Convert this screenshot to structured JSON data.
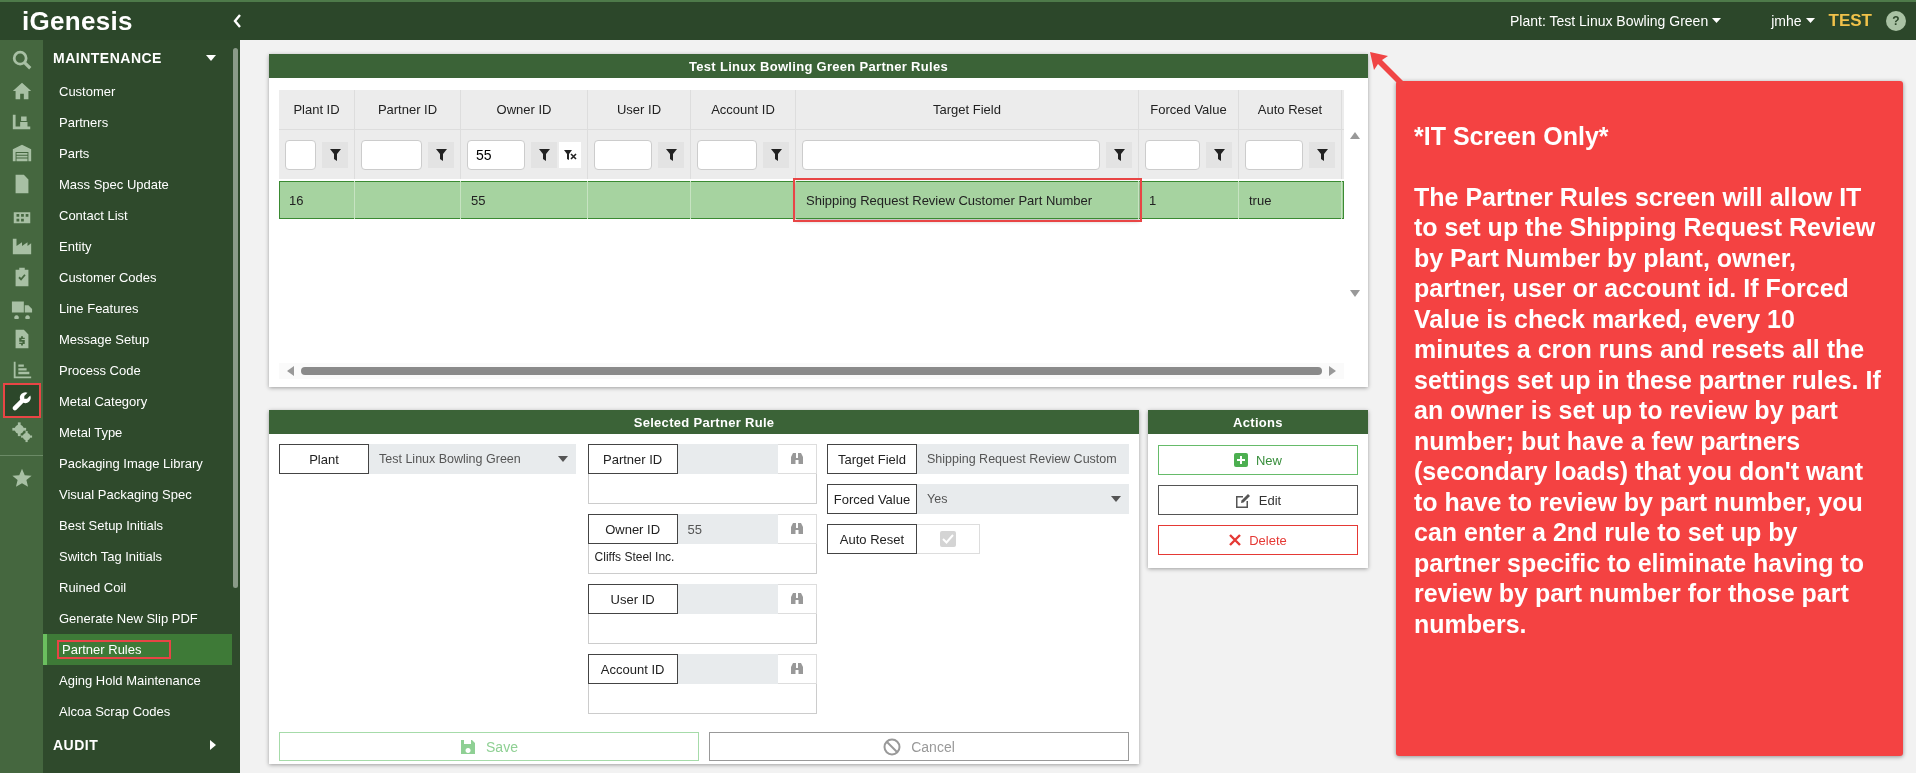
{
  "topbar": {
    "logo_prefix": "i",
    "logo_main": "Genesis",
    "plant_menu": "Plant: Test Linux Bowling Green",
    "user_menu": "jmhe",
    "environment": "TEST",
    "help": "?"
  },
  "rail_icons": [
    {
      "kind": "search",
      "selected": false,
      "highlighted": false
    },
    {
      "kind": "home",
      "selected": false,
      "highlighted": false
    },
    {
      "kind": "forklift",
      "selected": false,
      "highlighted": false
    },
    {
      "kind": "warehouse",
      "selected": false,
      "highlighted": false
    },
    {
      "kind": "document",
      "selected": false,
      "highlighted": false
    },
    {
      "kind": "calendar",
      "selected": false,
      "highlighted": false
    },
    {
      "kind": "factory",
      "selected": false,
      "highlighted": false
    },
    {
      "kind": "clipboard",
      "selected": false,
      "highlighted": false
    },
    {
      "kind": "truck",
      "selected": false,
      "highlighted": false
    },
    {
      "kind": "invoice",
      "selected": false,
      "highlighted": false
    },
    {
      "kind": "chart",
      "selected": false,
      "highlighted": false
    },
    {
      "kind": "wrench",
      "selected": true,
      "highlighted": true
    },
    {
      "kind": "gears",
      "selected": false,
      "highlighted": false
    },
    {
      "kind": "star",
      "selected": false,
      "highlighted": false
    }
  ],
  "menu": [
    {
      "title": "MAINTENANCE",
      "expanded": true,
      "items": [
        {
          "label": "Customer",
          "selected": false,
          "highlighted": false
        },
        {
          "label": "Partners",
          "selected": false,
          "highlighted": false
        },
        {
          "label": "Parts",
          "selected": false,
          "highlighted": false
        },
        {
          "label": "Mass Spec Update",
          "selected": false,
          "highlighted": false
        },
        {
          "label": "Contact List",
          "selected": false,
          "highlighted": false
        },
        {
          "label": "Entity",
          "selected": false,
          "highlighted": false
        },
        {
          "label": "Customer Codes",
          "selected": false,
          "highlighted": false
        },
        {
          "label": "Line Features",
          "selected": false,
          "highlighted": false
        },
        {
          "label": "Message Setup",
          "selected": false,
          "highlighted": false
        },
        {
          "label": "Process Code",
          "selected": false,
          "highlighted": false
        },
        {
          "label": "Metal Category",
          "selected": false,
          "highlighted": false
        },
        {
          "label": "Metal Type",
          "selected": false,
          "highlighted": false
        },
        {
          "label": "Packaging Image Library",
          "selected": false,
          "highlighted": false
        },
        {
          "label": "Visual Packaging Spec",
          "selected": false,
          "highlighted": false
        },
        {
          "label": "Best Setup Initials",
          "selected": false,
          "highlighted": false
        },
        {
          "label": "Switch Tag Initials",
          "selected": false,
          "highlighted": false
        },
        {
          "label": "Ruined Coil",
          "selected": false,
          "highlighted": false
        },
        {
          "label": "Generate New Slip PDF",
          "selected": false,
          "highlighted": false
        },
        {
          "label": "Partner Rules",
          "selected": true,
          "highlighted": true
        },
        {
          "label": "Aging Hold Maintenance",
          "selected": false,
          "highlighted": false
        },
        {
          "label": "Alcoa Scrap Codes",
          "selected": false,
          "highlighted": false
        }
      ]
    },
    {
      "title": "AUDIT",
      "expanded": false
    }
  ],
  "grid": {
    "title": "Test Linux Bowling Green Partner Rules",
    "columns": [
      {
        "label": "Plant ID"
      },
      {
        "label": "Partner ID"
      },
      {
        "label": "Owner ID",
        "filter_value": "55"
      },
      {
        "label": "User ID"
      },
      {
        "label": "Account ID"
      },
      {
        "label": "Target Field"
      },
      {
        "label": "Forced Value"
      },
      {
        "label": "Auto Reset"
      }
    ],
    "rows": [
      {
        "selected": true,
        "cells": [
          {
            "text": "16",
            "highlighted": false
          },
          {
            "highlighted": false
          },
          {
            "text": "55",
            "highlighted": false
          },
          {
            "highlighted": false
          },
          {
            "highlighted": false
          },
          {
            "text": "Shipping Request Review Customer Part Number",
            "highlighted": true
          },
          {
            "text": "1",
            "highlighted": false
          },
          {
            "text": "true",
            "highlighted": false
          }
        ]
      }
    ]
  },
  "form": {
    "title": "Selected Partner Rule",
    "plant": {
      "label": "Plant",
      "value": "Test Linux Bowling Green"
    },
    "lookups": [
      {
        "label": "Partner ID"
      },
      {
        "label": "Owner ID",
        "value": "55",
        "description": "Cliffs Steel Inc."
      },
      {
        "label": "User ID"
      },
      {
        "label": "Account ID"
      }
    ],
    "right_fields": [
      {
        "kind": "dropdown",
        "label": "Target Field",
        "value": "Shipping Request Review Custom"
      },
      {
        "kind": "dropdown",
        "label": "Forced Value",
        "value": "Yes"
      },
      {
        "kind": "checkbox",
        "label": "Auto Reset",
        "checked": true,
        "disabled": true
      }
    ],
    "buttons": [
      {
        "kind": "save",
        "label": "Save",
        "disabled": true
      },
      {
        "kind": "cancel",
        "label": "Cancel",
        "disabled": true
      }
    ]
  },
  "actions": {
    "title": "Actions",
    "buttons": [
      {
        "kind": "new",
        "label": "New"
      },
      {
        "kind": "edit",
        "label": "Edit"
      },
      {
        "kind": "delete",
        "label": "Delete"
      }
    ]
  },
  "callout": {
    "heading": "*IT Screen Only*",
    "body": "The Partner Rules screen will allow IT to set up the Shipping Request Review by Part Number by plant, owner, partner, user or account id. If Forced Value is check marked, every 10 minutes a cron runs and resets all the settings set up in these partner rules. If an owner is set up to review by part number; but have a few partners (secondary loads) that you don't want to have to review by part number, you can enter a 2nd rule to set up by partner specific to eliminate having to review by part number for those part numbers."
  }
}
